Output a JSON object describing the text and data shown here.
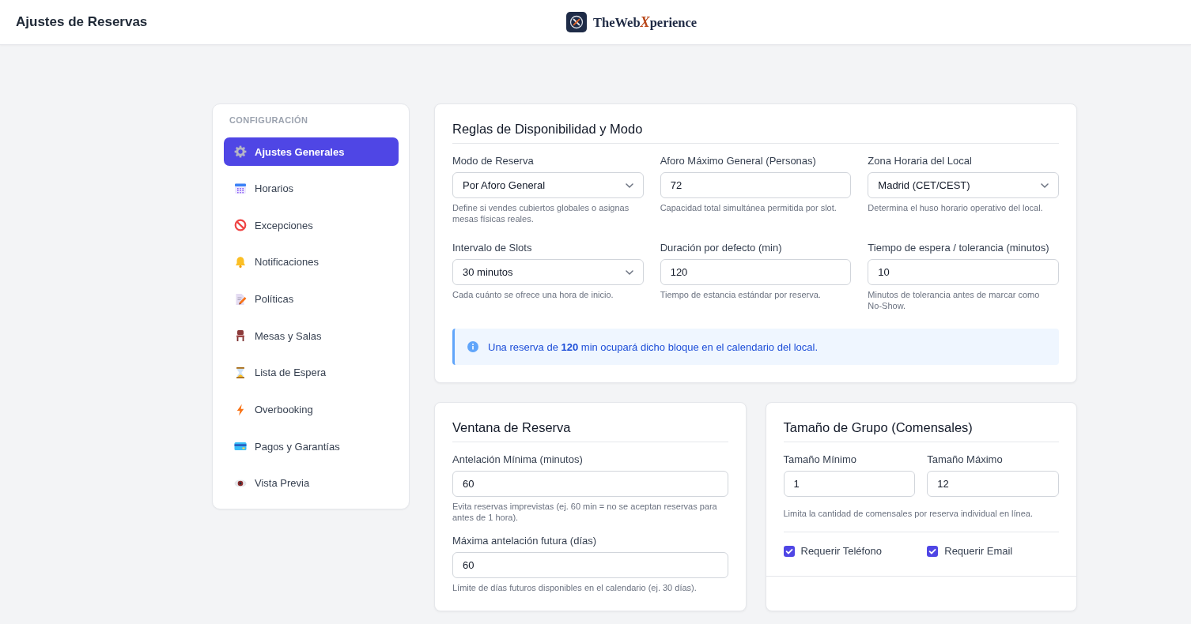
{
  "header": {
    "title": "Ajustes de Reservas",
    "logo": [
      {
        "text": "TheWeb",
        "accent": false
      },
      {
        "text": "X",
        "accent": true
      },
      {
        "text": "perience",
        "accent": false
      }
    ]
  },
  "sidebar": {
    "heading": "CONFIGURACIÓN",
    "items": [
      {
        "label": "Ajustes Generales",
        "selected": true
      },
      {
        "label": "Horarios",
        "selected": false
      },
      {
        "label": "Excepciones",
        "selected": false
      },
      {
        "label": "Notificaciones",
        "selected": false
      },
      {
        "label": "Políticas",
        "selected": false
      },
      {
        "label": "Mesas y Salas",
        "selected": false
      },
      {
        "label": "Lista de Espera",
        "selected": false
      },
      {
        "label": "Overbooking",
        "selected": false
      },
      {
        "label": "Pagos y Garantías",
        "selected": false
      },
      {
        "label": "Vista Previa",
        "selected": false
      }
    ]
  },
  "availability": {
    "title": "Reglas de Disponibilidad y Modo",
    "fields": [
      {
        "kind": "select",
        "label": "Modo de Reserva",
        "value": "Por Aforo General",
        "help": "Define si vendes cubiertos globales o asignas mesas físicas reales."
      },
      {
        "kind": "input",
        "label": "Aforo Máximo General (Personas)",
        "value": "72",
        "help": "Capacidad total simultánea permitida por slot."
      },
      {
        "kind": "select",
        "label": "Zona Horaria del Local",
        "value": "Madrid (CET/CEST)",
        "help": "Determina el huso horario operativo del local."
      },
      {
        "kind": "select",
        "label": "Intervalo de Slots",
        "value": "30 minutos",
        "help": "Cada cuánto se ofrece una hora de inicio."
      },
      {
        "kind": "input",
        "label": "Duración por defecto (min)",
        "value": "120",
        "help": "Tiempo de estancia estándar por reserva."
      },
      {
        "kind": "input",
        "label": "Tiempo de espera / tolerancia (minutos)",
        "value": "10",
        "help": "Minutos de tolerancia antes de marcar como No-Show."
      }
    ],
    "info": "Una reserva de **120** min ocupará dicho bloque en el calendario del local."
  },
  "booking_window": {
    "title": "Ventana de Reserva",
    "fields": [
      {
        "kind": "input",
        "label": "Antelación Mínima (minutos)",
        "value": "60",
        "help": "Evita reservas imprevistas (ej. 60 min = no se aceptan reservas para antes de 1 hora)."
      },
      {
        "kind": "input",
        "label": "Máxima antelación futura (días)",
        "value": "60",
        "help": "Límite de días futuros disponibles en el calendario (ej. 30 días)."
      }
    ]
  },
  "group_size": {
    "title": "Tamaño de Grupo (Comensales)",
    "fields": [
      {
        "kind": "input",
        "label": "Tamaño Mínimo",
        "value": "1"
      },
      {
        "kind": "input",
        "label": "Tamaño Máximo",
        "value": "12"
      }
    ],
    "help": "Limita la cantidad de comensales por reserva individual en línea.",
    "checkboxes": [
      {
        "label": "Requerir Teléfono",
        "checked": true
      },
      {
        "label": "Requerir Email",
        "checked": true
      }
    ]
  }
}
